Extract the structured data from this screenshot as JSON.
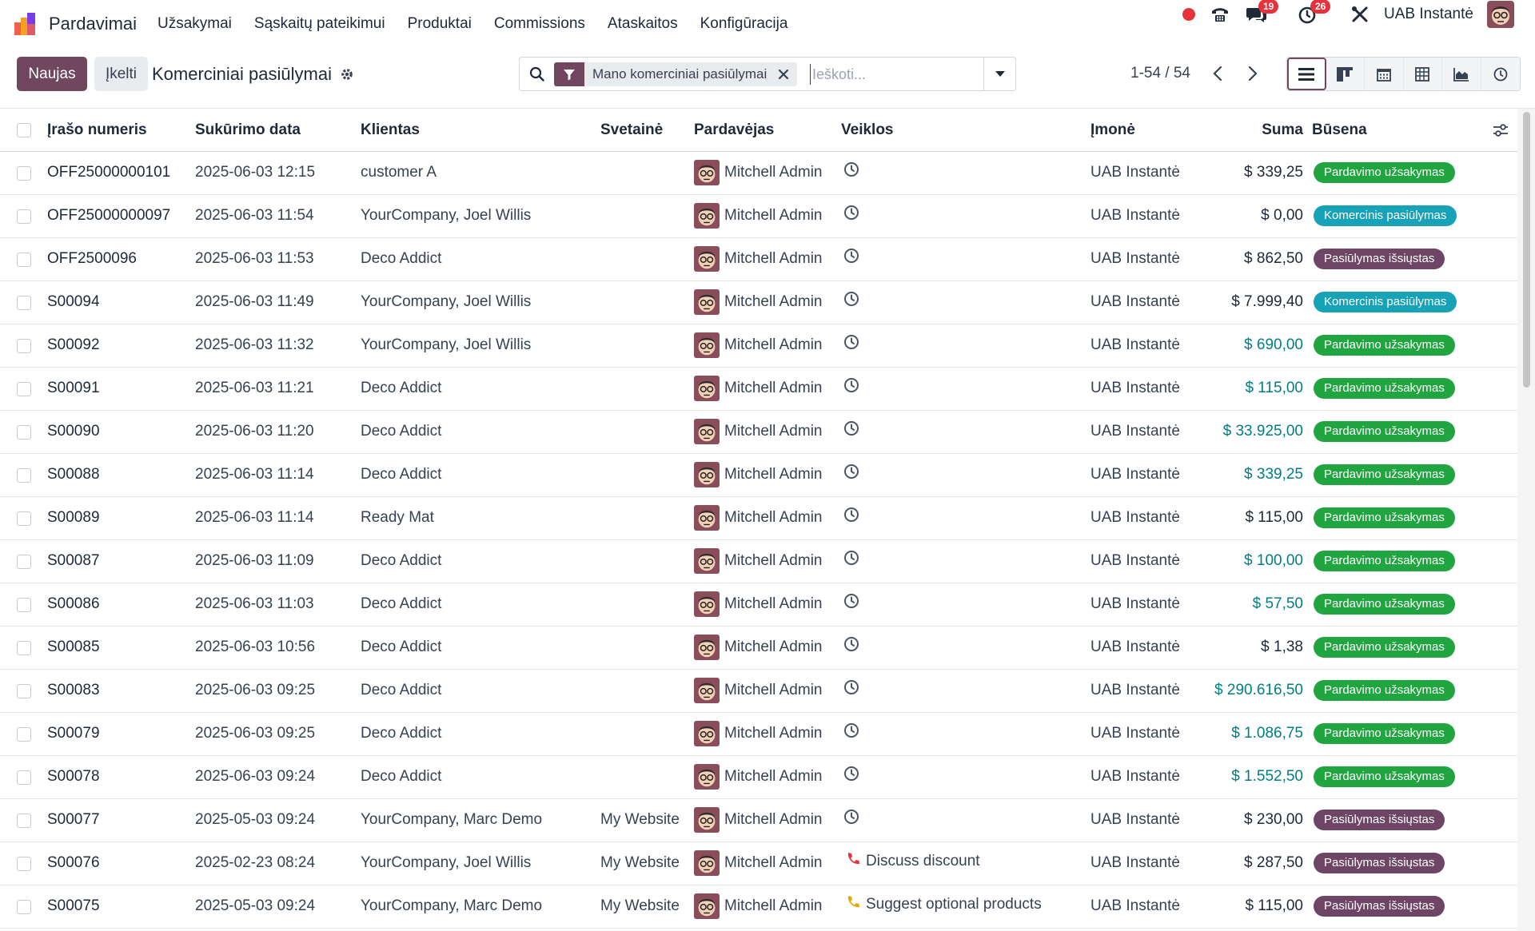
{
  "navbar": {
    "app_name": "Pardavimai",
    "menu": [
      "Užsakymai",
      "Sąskaitų pateikimui",
      "Produktai",
      "Commissions",
      "Ataskaitos",
      "Konfigūracija"
    ],
    "messages_count": "19",
    "activities_count": "26",
    "company": "UAB Instantė"
  },
  "control": {
    "new_label": "Naujas",
    "import_label": "Įkelti",
    "title": "Komerciniai pasiūlymai",
    "facet": "Mano komerciniai pasiūlymai",
    "search_placeholder": "Ieškoti...",
    "pager": "1-54 / 54"
  },
  "columns": {
    "number": "Įrašo numeris",
    "date": "Sukūrimo data",
    "client": "Klientas",
    "website": "Svetainė",
    "salesperson": "Pardavėjas",
    "activities": "Veiklos",
    "company": "Įmonė",
    "amount": "Suma",
    "status": "Būsena"
  },
  "rows": [
    {
      "number": "OFF25000000101",
      "date": "2025-06-03 12:15",
      "client": "customer A",
      "website": "",
      "salesperson": "Mitchell Admin",
      "activity": "",
      "company": "UAB Instantė",
      "amount": "$ 339,25",
      "amount_link": false,
      "status": "Pardavimo užsakymas",
      "status_type": "green"
    },
    {
      "number": "OFF25000000097",
      "date": "2025-06-03 11:54",
      "client": "YourCompany, Joel Willis",
      "website": "",
      "salesperson": "Mitchell Admin",
      "activity": "",
      "company": "UAB Instantė",
      "amount": "$ 0,00",
      "amount_link": false,
      "status": "Komercinis pasiūlymas",
      "status_type": "teal"
    },
    {
      "number": "OFF2500096",
      "date": "2025-06-03 11:53",
      "client": "Deco Addict",
      "website": "",
      "salesperson": "Mitchell Admin",
      "activity": "",
      "company": "UAB Instantė",
      "amount": "$ 862,50",
      "amount_link": false,
      "status": "Pasiūlymas išsiųstas",
      "status_type": "purple"
    },
    {
      "number": "S00094",
      "date": "2025-06-03 11:49",
      "client": "YourCompany, Joel Willis",
      "website": "",
      "salesperson": "Mitchell Admin",
      "activity": "",
      "company": "UAB Instantė",
      "amount": "$ 7.999,40",
      "amount_link": false,
      "status": "Komercinis pasiūlymas",
      "status_type": "teal"
    },
    {
      "number": "S00092",
      "date": "2025-06-03 11:32",
      "client": "YourCompany, Joel Willis",
      "website": "",
      "salesperson": "Mitchell Admin",
      "activity": "",
      "company": "UAB Instantė",
      "amount": "$ 690,00",
      "amount_link": true,
      "status": "Pardavimo užsakymas",
      "status_type": "green"
    },
    {
      "number": "S00091",
      "date": "2025-06-03 11:21",
      "client": "Deco Addict",
      "website": "",
      "salesperson": "Mitchell Admin",
      "activity": "",
      "company": "UAB Instantė",
      "amount": "$ 115,00",
      "amount_link": true,
      "status": "Pardavimo užsakymas",
      "status_type": "green"
    },
    {
      "number": "S00090",
      "date": "2025-06-03 11:20",
      "client": "Deco Addict",
      "website": "",
      "salesperson": "Mitchell Admin",
      "activity": "",
      "company": "UAB Instantė",
      "amount": "$ 33.925,00",
      "amount_link": true,
      "status": "Pardavimo užsakymas",
      "status_type": "green"
    },
    {
      "number": "S00088",
      "date": "2025-06-03 11:14",
      "client": "Deco Addict",
      "website": "",
      "salesperson": "Mitchell Admin",
      "activity": "",
      "company": "UAB Instantė",
      "amount": "$ 339,25",
      "amount_link": true,
      "status": "Pardavimo užsakymas",
      "status_type": "green"
    },
    {
      "number": "S00089",
      "date": "2025-06-03 11:14",
      "client": "Ready Mat",
      "website": "",
      "salesperson": "Mitchell Admin",
      "activity": "",
      "company": "UAB Instantė",
      "amount": "$ 115,00",
      "amount_link": false,
      "status": "Pardavimo užsakymas",
      "status_type": "green"
    },
    {
      "number": "S00087",
      "date": "2025-06-03 11:09",
      "client": "Deco Addict",
      "website": "",
      "salesperson": "Mitchell Admin",
      "activity": "",
      "company": "UAB Instantė",
      "amount": "$ 100,00",
      "amount_link": true,
      "status": "Pardavimo užsakymas",
      "status_type": "green"
    },
    {
      "number": "S00086",
      "date": "2025-06-03 11:03",
      "client": "Deco Addict",
      "website": "",
      "salesperson": "Mitchell Admin",
      "activity": "",
      "company": "UAB Instantė",
      "amount": "$ 57,50",
      "amount_link": true,
      "status": "Pardavimo užsakymas",
      "status_type": "green"
    },
    {
      "number": "S00085",
      "date": "2025-06-03 10:56",
      "client": "Deco Addict",
      "website": "",
      "salesperson": "Mitchell Admin",
      "activity": "",
      "company": "UAB Instantė",
      "amount": "$ 1,38",
      "amount_link": false,
      "status": "Pardavimo užsakymas",
      "status_type": "green"
    },
    {
      "number": "S00083",
      "date": "2025-06-03 09:25",
      "client": "Deco Addict",
      "website": "",
      "salesperson": "Mitchell Admin",
      "activity": "",
      "company": "UAB Instantė",
      "amount": "$ 290.616,50",
      "amount_link": true,
      "status": "Pardavimo užsakymas",
      "status_type": "green"
    },
    {
      "number": "S00079",
      "date": "2025-06-03 09:25",
      "client": "Deco Addict",
      "website": "",
      "salesperson": "Mitchell Admin",
      "activity": "",
      "company": "UAB Instantė",
      "amount": "$ 1.086,75",
      "amount_link": true,
      "status": "Pardavimo užsakymas",
      "status_type": "green"
    },
    {
      "number": "S00078",
      "date": "2025-06-03 09:24",
      "client": "Deco Addict",
      "website": "",
      "salesperson": "Mitchell Admin",
      "activity": "",
      "company": "UAB Instantė",
      "amount": "$ 1.552,50",
      "amount_link": true,
      "status": "Pardavimo užsakymas",
      "status_type": "green"
    },
    {
      "number": "S00077",
      "date": "2025-05-03 09:24",
      "client": "YourCompany, Marc Demo",
      "website": "My Website",
      "salesperson": "Mitchell Admin",
      "activity": "",
      "company": "UAB Instantė",
      "amount": "$ 230,00",
      "amount_link": false,
      "status": "Pasiūlymas išsiųstas",
      "status_type": "purple"
    },
    {
      "number": "S00076",
      "date": "2025-02-23 08:24",
      "client": "YourCompany, Joel Willis",
      "website": "My Website",
      "salesperson": "Mitchell Admin",
      "activity": "Discuss discount",
      "activity_color": "#e5323b",
      "company": "UAB Instantė",
      "amount": "$ 287,50",
      "amount_link": false,
      "status": "Pasiūlymas išsiųstas",
      "status_type": "purple"
    },
    {
      "number": "S00075",
      "date": "2025-05-03 09:24",
      "client": "YourCompany, Marc Demo",
      "website": "My Website",
      "salesperson": "Mitchell Admin",
      "activity": "Suggest optional products",
      "activity_color": "#e0a800",
      "company": "UAB Instantė",
      "amount": "$ 115,00",
      "amount_link": false,
      "status": "Pasiūlymas išsiųstas",
      "status_type": "purple"
    }
  ]
}
